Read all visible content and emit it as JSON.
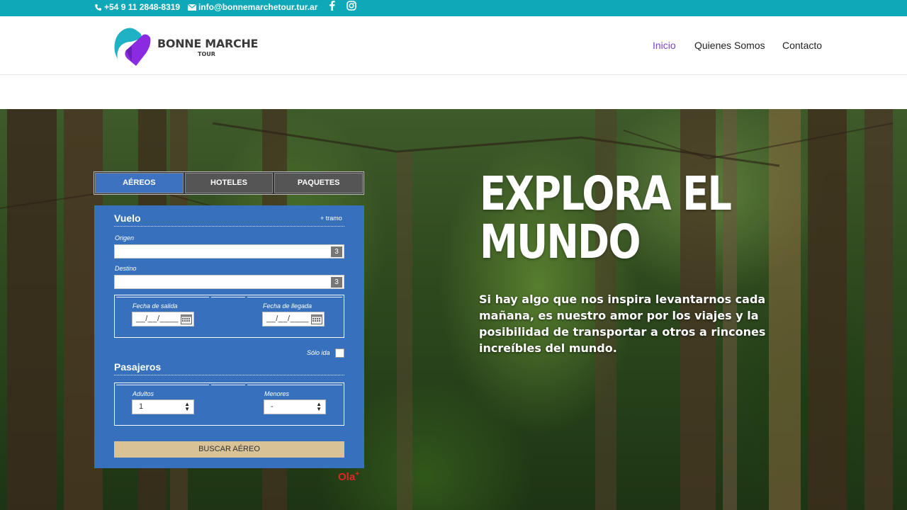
{
  "topbar": {
    "phone": "+54 9 11 2848-8319",
    "email": "info@bonnemarchetour.tur.ar",
    "icons": [
      "phone-icon",
      "envelope-icon",
      "facebook-icon",
      "instagram-icon"
    ],
    "color": "#0fa8b8"
  },
  "header": {
    "logo_text": "BONNE MARCHE",
    "logo_sub": "TOUR",
    "nav": [
      {
        "label": "Inicio",
        "active": true
      },
      {
        "label": "Quienes Somos",
        "active": false
      },
      {
        "label": "Contacto",
        "active": false
      }
    ],
    "active_color": "#7b46c8"
  },
  "hero": {
    "title_line1": "EXPLORA EL",
    "title_line2": "MUNDO",
    "subtitle": "Si hay algo que nos inspira levantarnos cada mañana, es nuestro amor por los viajes y la posibilidad de transportar a otros a rincones increíbles del mundo."
  },
  "booking": {
    "tabs": [
      {
        "label": "AÉREOS",
        "active": true
      },
      {
        "label": "HOTELES",
        "active": false
      },
      {
        "label": "PAQUETES",
        "active": false
      }
    ],
    "vuelo_title": "Vuelo",
    "add_leg": "+ tramo",
    "origin_label": "Origen",
    "origin_value": "",
    "origin_badge": "3",
    "destination_label": "Destino",
    "destination_value": "",
    "destination_badge": "3",
    "departure_label": "Fecha de salida",
    "departure_value": "__/__/____",
    "arrival_label": "Fecha de llegada",
    "arrival_value": "__/__/____",
    "one_way_label": "Sólo ida",
    "one_way_checked": false,
    "passengers_title": "Pasajeros",
    "adults_label": "Adultos",
    "adults_value": "1",
    "minors_label": "Menores",
    "minors_value": "-",
    "search_button": "BUSCAR AÉREO",
    "panel_color": "#3771be",
    "button_color": "#d9c295",
    "powered_by": "Ola",
    "powered_by_mark": "+"
  }
}
